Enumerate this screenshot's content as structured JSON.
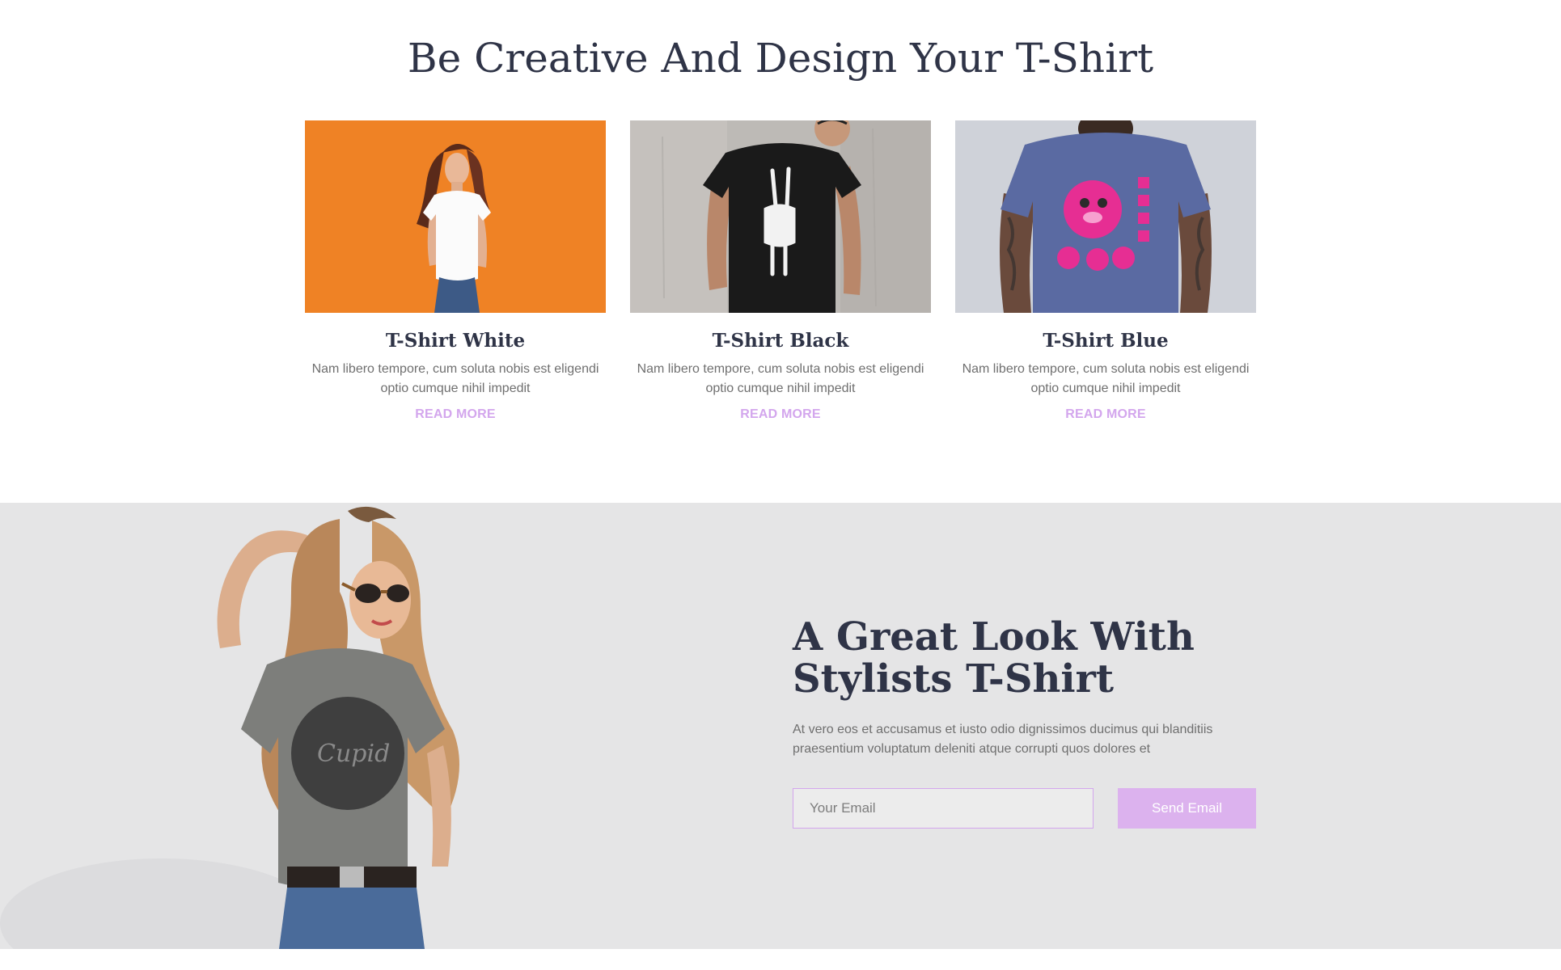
{
  "products": {
    "title": "Be Creative And Design Your T-Shirt",
    "cards": [
      {
        "title": "T-Shirt White",
        "text": "Nam libero tempore, cum soluta nobis est eligendi optio cumque nihil impedit",
        "link": "READ MORE"
      },
      {
        "title": "T-Shirt Black",
        "text": "Nam libero tempore, cum soluta nobis est eligendi optio cumque nihil impedit",
        "link": "READ MORE"
      },
      {
        "title": "T-Shirt Blue",
        "text": "Nam libero tempore, cum soluta nobis est eligendi optio cumque nihil impedit",
        "link": "READ MORE"
      }
    ]
  },
  "newsletter": {
    "title": "A Great Look With Stylists T-Shirt",
    "text": "At vero eos et accusamus et iusto odio dignissimos ducimus qui blanditiis praesentium voluptatum deleniti atque corrupti quos dolores et",
    "email_placeholder": "Your Email",
    "button_label": "Send Email"
  },
  "colors": {
    "heading": "#2f3447",
    "body_text": "#6f6f6f",
    "accent": "#d3a6ed",
    "section_bg": "#e5e5e6"
  }
}
